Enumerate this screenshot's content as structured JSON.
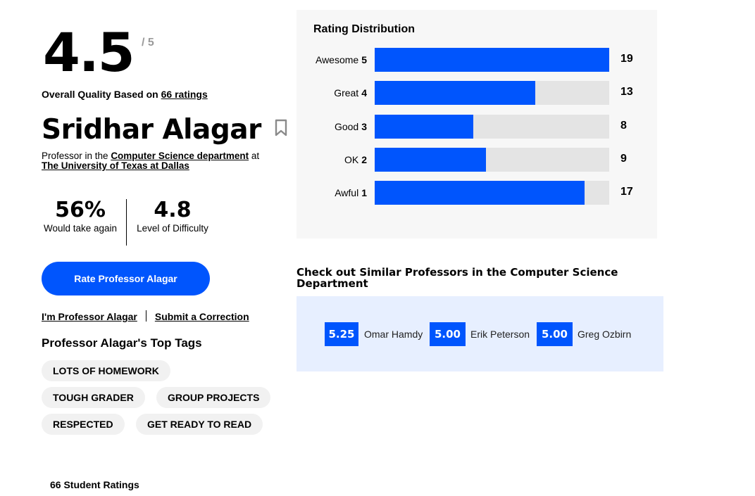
{
  "overall": {
    "score": "4.5",
    "out_of": "/ 5",
    "based_on_prefix": "Overall Quality Based on",
    "ratings_link": "66 ratings"
  },
  "professor": {
    "name": "Sridhar Alagar",
    "dept_prefix": "Professor in the",
    "dept_link": "Computer Science department",
    "dept_suffix": "at",
    "school_link": "The University of Texas at Dallas"
  },
  "feedback": {
    "take_again_value": "56%",
    "take_again_label": "Would take again",
    "difficulty_value": "4.8",
    "difficulty_label": "Level of Difficulty"
  },
  "actions": {
    "rate_button": "Rate Professor Alagar",
    "claim_link": "I'm Professor Alagar",
    "correction_link": "Submit a Correction"
  },
  "tags": {
    "title": "Professor Alagar's Top Tags",
    "items": [
      "LOTS OF HOMEWORK",
      "TOUGH GRADER",
      "GROUP PROJECTS",
      "RESPECTED",
      "GET READY TO READ"
    ]
  },
  "distribution": {
    "title": "Rating Distribution",
    "max": 19,
    "rows": [
      {
        "label": "Awesome",
        "rating": "5",
        "count": 19
      },
      {
        "label": "Great",
        "rating": "4",
        "count": 13
      },
      {
        "label": "Good",
        "rating": "3",
        "count": 8
      },
      {
        "label": "OK",
        "rating": "2",
        "count": 9
      },
      {
        "label": "Awful",
        "rating": "1",
        "count": 17
      }
    ]
  },
  "similar": {
    "title": "Check out Similar Professors in the Computer Science Department",
    "items": [
      {
        "score": "5.25",
        "name": "Omar Hamdy"
      },
      {
        "score": "5.00",
        "name": "Erik Peterson"
      },
      {
        "score": "5.00",
        "name": "Greg Ozbirn"
      }
    ]
  },
  "student_ratings": "66 Student Ratings",
  "colors": {
    "accent": "#0055fd",
    "track": "#e4e4e4",
    "panel": "#f7f7f7",
    "similar_bg": "#e7efff",
    "tag_bg": "#f1f1f1"
  },
  "icons": {
    "bookmark": "bookmark-icon"
  }
}
